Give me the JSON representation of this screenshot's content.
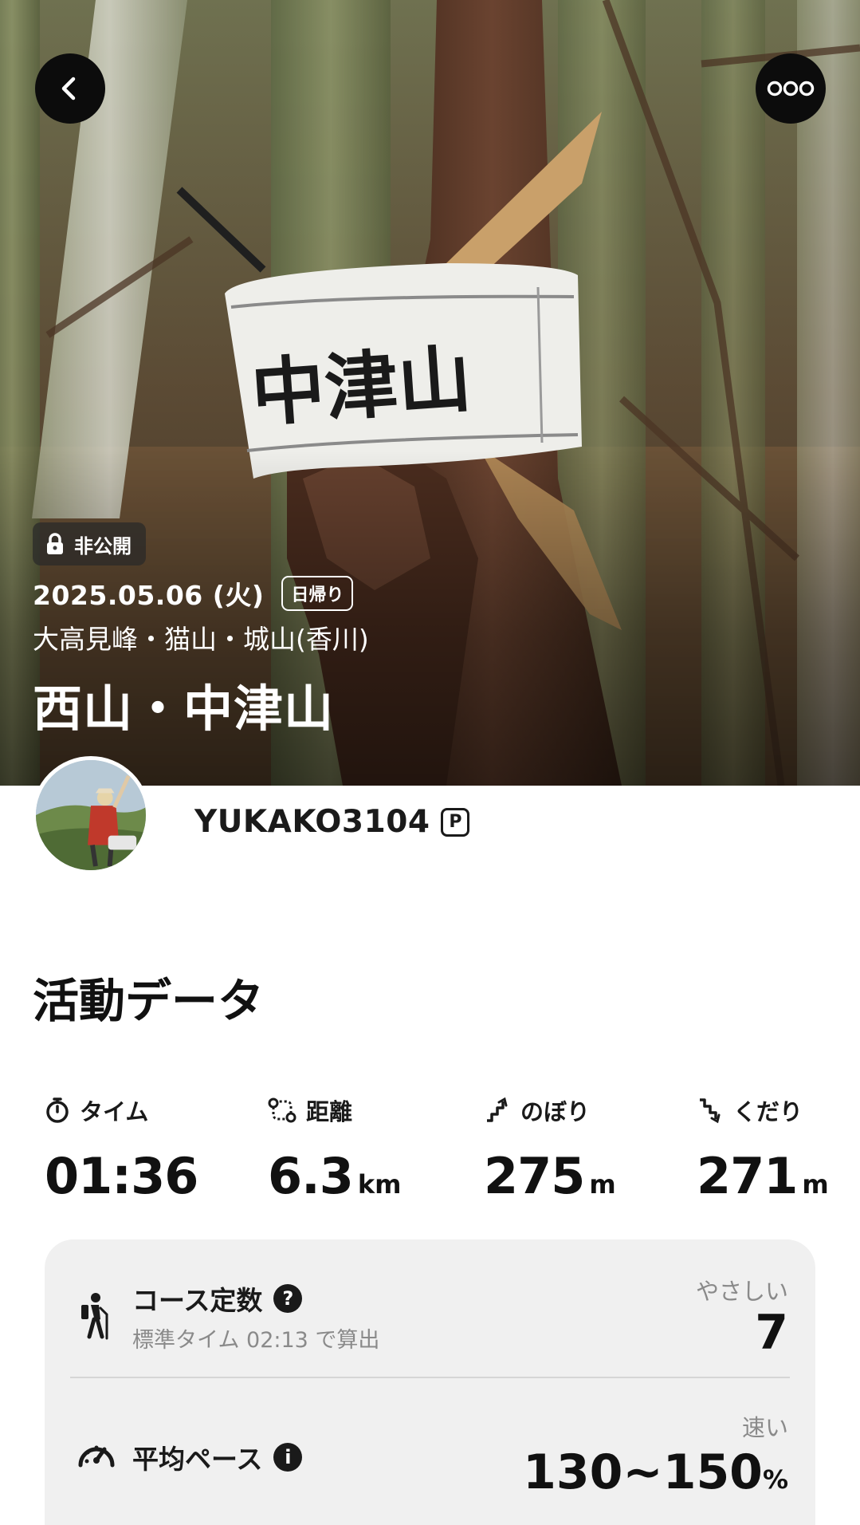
{
  "header": {
    "back_icon": "chevron-left-icon",
    "more_icon": "more-horizontal-icon"
  },
  "hero": {
    "visibility": "非公開",
    "date": "2025.05.06 (火)",
    "trip_type": "日帰り",
    "area": "大高見峰・猫山・城山(香川)",
    "title": "西山・中津山",
    "sign_text": "中津山"
  },
  "user": {
    "username": "YUKAKO3104",
    "premium_badge": "P"
  },
  "activity": {
    "section_title": "活動データ",
    "stats": [
      {
        "icon": "stopwatch-icon",
        "label": "タイム",
        "value": "01:36",
        "unit": ""
      },
      {
        "icon": "route-icon",
        "label": "距離",
        "value": "6.3",
        "unit": "km"
      },
      {
        "icon": "ascent-icon",
        "label": "のぼり",
        "value": "275",
        "unit": "m"
      },
      {
        "icon": "descent-icon",
        "label": "くだり",
        "value": "271",
        "unit": "m"
      }
    ],
    "course": {
      "label": "コース定数",
      "help": "?",
      "sub": "標準タイム 02:13 で算出",
      "rating": "やさしい",
      "value": "7"
    },
    "pace": {
      "label": "平均ペース",
      "info": "i",
      "rating": "速い",
      "value": "130~150",
      "unit": "%"
    }
  },
  "colors": {
    "accent_dark": "#111111",
    "card_background": "#f0f0f0",
    "muted_text": "#8a8a8a"
  }
}
